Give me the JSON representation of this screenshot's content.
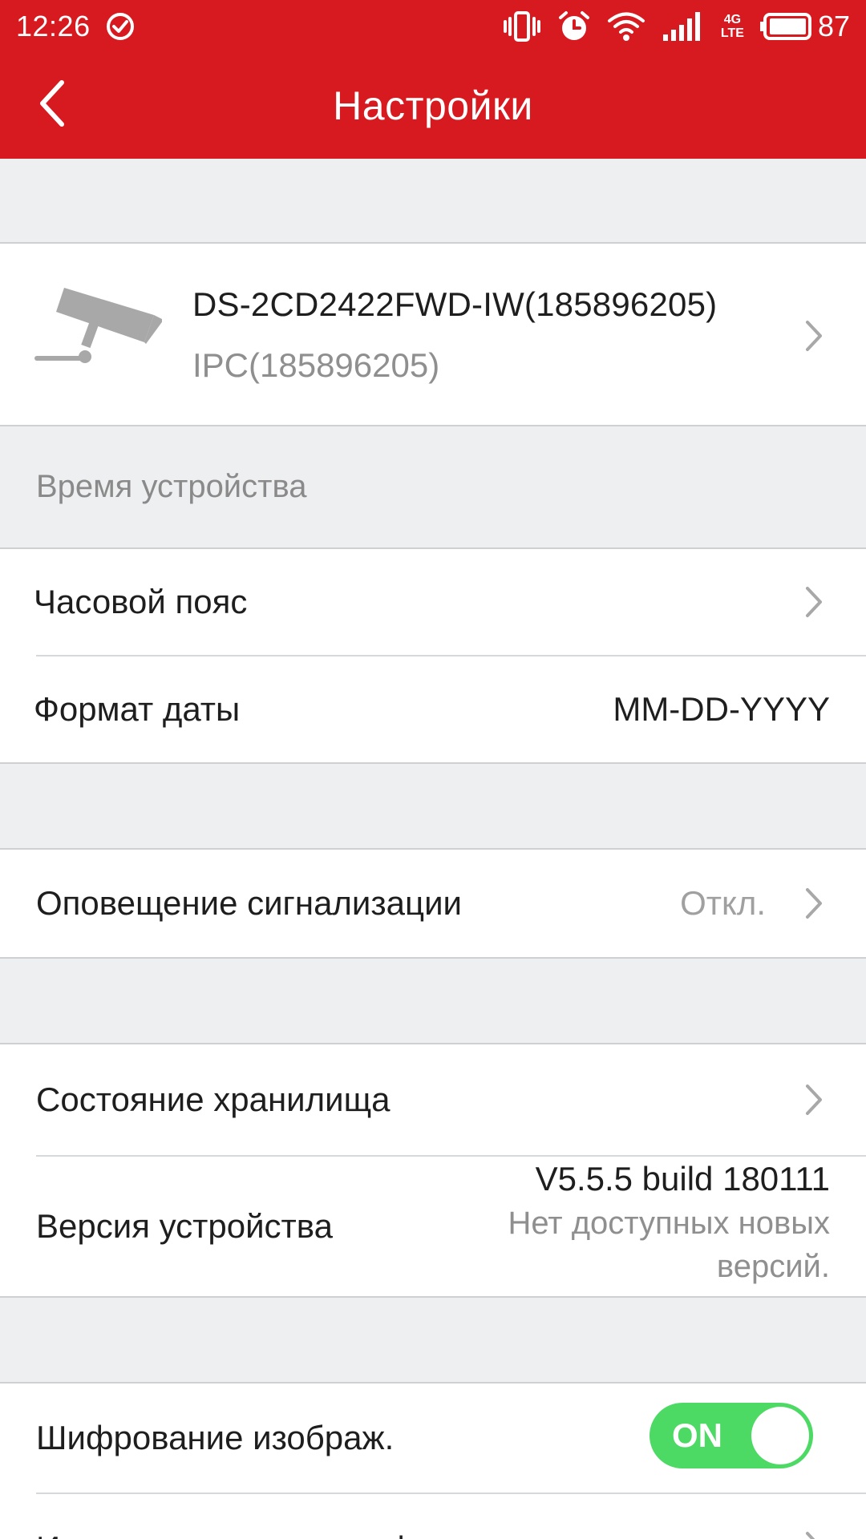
{
  "status_bar": {
    "time": "12:26",
    "battery_percent": "87",
    "network_label_top": "4G",
    "network_label_bottom": "LTE",
    "icons": [
      "check-circle-icon",
      "vibrate-icon",
      "alarm-icon",
      "wifi-icon",
      "signal-icon",
      "battery-icon"
    ]
  },
  "header": {
    "title": "Настройки",
    "back_icon": "chevron-left-icon",
    "color": "#d71920"
  },
  "device": {
    "name": "DS-2CD2422FWD-IW(185896205)",
    "type": "IPC(185896205)",
    "icon": "camera-icon"
  },
  "sections": {
    "device_time_header": "Время устройства",
    "timezone_label": "Часовой пояс",
    "date_format_label": "Формат даты",
    "date_format_value": "MM-DD-YYYY",
    "alarm_label": "Оповещение сигнализации",
    "alarm_value": "Откл.",
    "storage_label": "Состояние хранилища",
    "version_label": "Версия устройства",
    "version_value": "V5.5.5 build 180111",
    "version_status_line1": "Нет доступных новых",
    "version_status_line2": "версий.",
    "encryption_label": "Шифрование изображ.",
    "encryption_toggle_label": "ON",
    "encryption_on": true,
    "next_label_partial": "Изменение пароля шифрования"
  },
  "colors": {
    "accent": "#d71920",
    "toggle_on": "#4cd964",
    "background": "#eeeff1"
  }
}
